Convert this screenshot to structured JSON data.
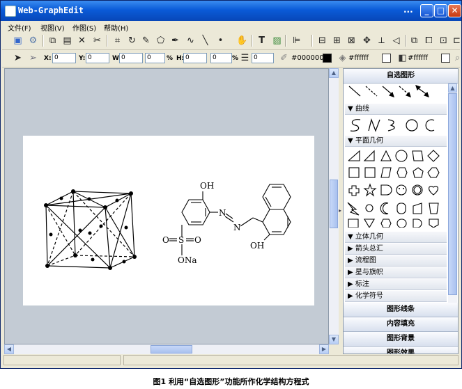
{
  "window": {
    "title": "Web-GraphEdit",
    "title_dots": "...",
    "min_glyph": "_",
    "max_glyph": "□",
    "close_glyph": "✕"
  },
  "menu": [
    "文件(F)",
    "视图(V)",
    "作图(S)",
    "帮助(H)"
  ],
  "props": {
    "x_label": "X:",
    "x_value": "0",
    "y_label": "Y:",
    "y_value": "0",
    "w_label": "W:",
    "w_value": "0",
    "w_pct": "0",
    "pct1": "%",
    "h_label": "H:",
    "h_value": "0",
    "h_pct": "0",
    "pct2": "%",
    "line_width": "0",
    "stroke_color": "#000000",
    "fill_color": "#ffffff",
    "bg_color": "#ffffff"
  },
  "panel": {
    "title": "自选图形",
    "groups": {
      "curve": "▼ 曲线",
      "plane": "▼ 平面几何",
      "solid": "▼ 立体几何",
      "arrows": "▶ 箭头总汇",
      "flow": "▶ 流程图",
      "stars": "▶ 星与旗帜",
      "callouts": "▶ 标注",
      "chem": "▶ 化学符号"
    },
    "sections": {
      "line_style": "图形线条",
      "fill": "内容填充",
      "background": "图形背景",
      "effect": "图形效果"
    }
  },
  "canvas": {
    "chem_labels": {
      "oh_top": "OH",
      "oh_bottom": "OH",
      "n1": "N",
      "n2": "N",
      "s": "S",
      "o_left": "O",
      "o_right": "O",
      "ona": "ONa"
    }
  },
  "caption": "图1   利用“自选图形”功能所作化学结构方程式"
}
